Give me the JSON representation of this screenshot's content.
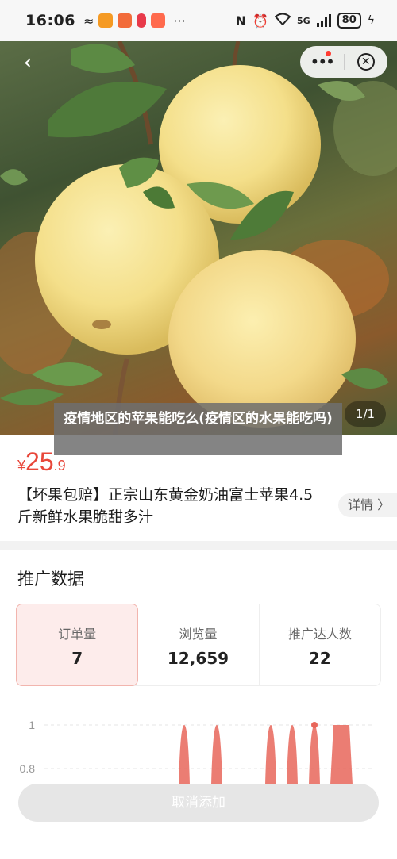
{
  "status_bar": {
    "time": "16:06",
    "network": "5G",
    "battery": "80"
  },
  "hero": {
    "page_indicator": "1/1",
    "title": "疫情地区的苹果能吃么(疫情区的水果能吃吗)"
  },
  "product": {
    "price_symbol": "¥",
    "price_integer": "25",
    "price_decimal": ".9",
    "name": "【坏果包赔】正宗山东黄金奶油富士苹果4.5斤新鲜水果脆甜多汁",
    "detail_label": "详情 〉"
  },
  "promo": {
    "title": "推广数据",
    "stats": [
      {
        "label": "订单量",
        "value": "7"
      },
      {
        "label": "浏览量",
        "value": "12,659"
      },
      {
        "label": "推广达人数",
        "value": "22"
      }
    ]
  },
  "chart_data": {
    "type": "line",
    "y_ticks": [
      "1",
      "0.8"
    ],
    "ylim": [
      0.8,
      1
    ],
    "accent_color": "#e8665a",
    "grid": true
  },
  "actions": {
    "cancel_label": "取消添加"
  },
  "colors": {
    "price": "#e8473a",
    "active_stat_bg": "#fdeceb"
  }
}
